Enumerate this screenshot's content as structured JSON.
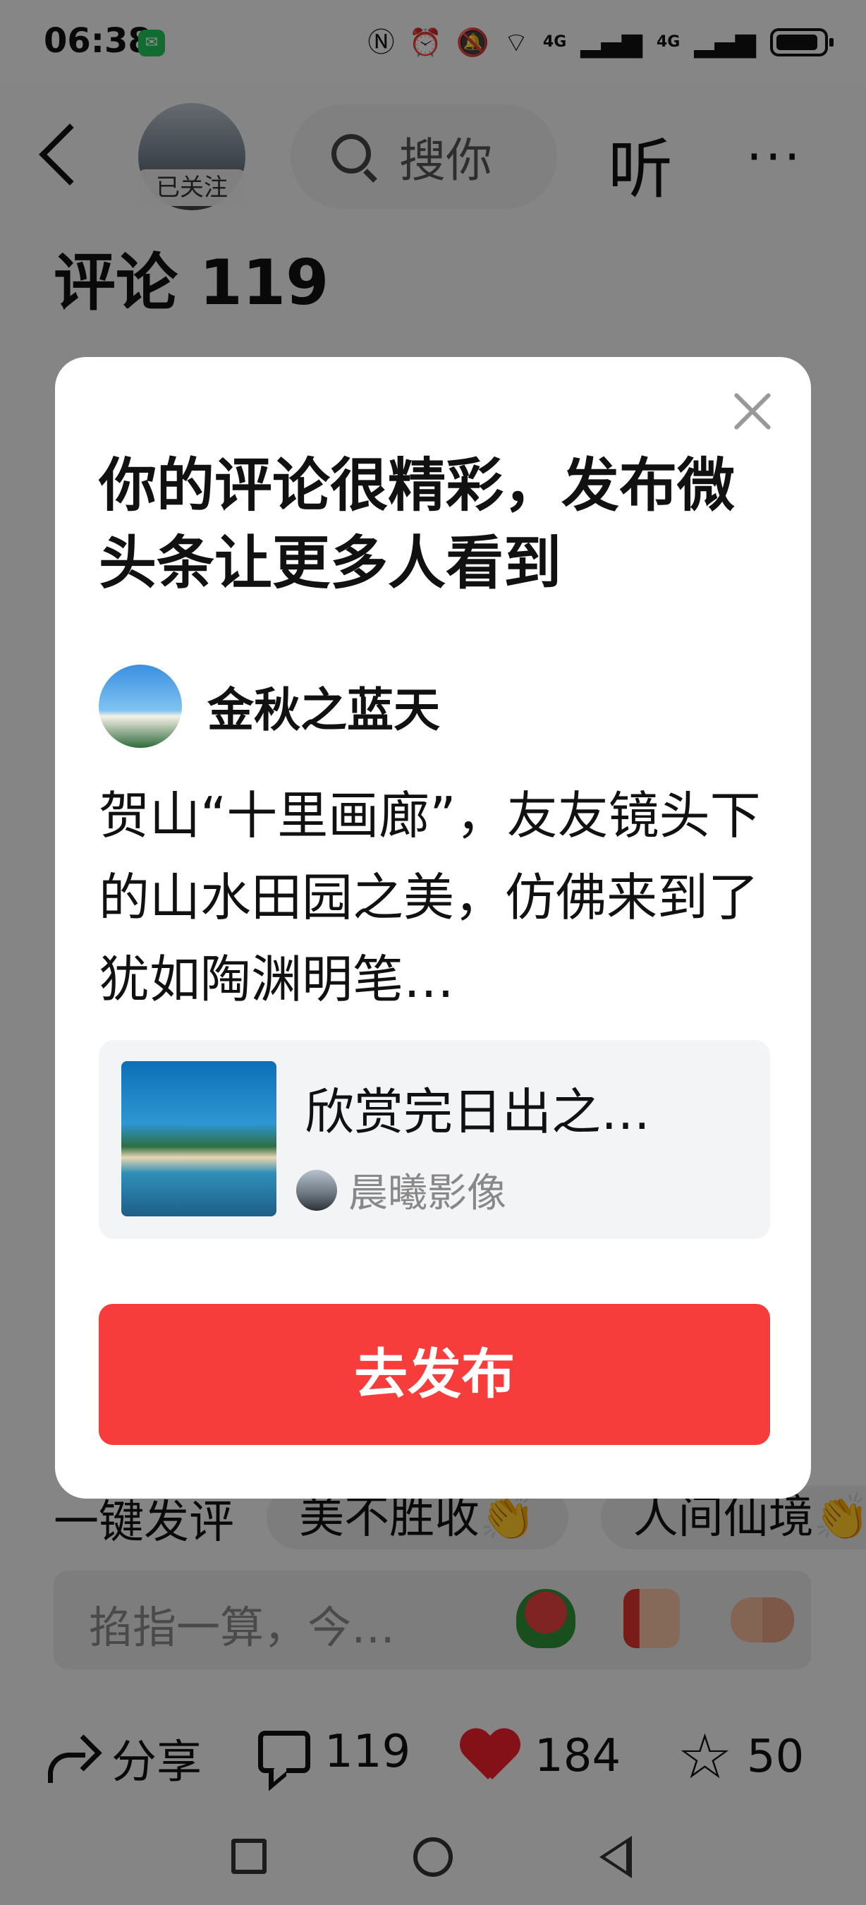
{
  "status_bar": {
    "time": "06:38",
    "network_1": "4G",
    "network_2": "4G"
  },
  "header": {
    "follow_badge": "已关注",
    "search_placeholder": "搜你",
    "listen_label": "听",
    "more_label": "···"
  },
  "comments_title": "评论 119",
  "dialog": {
    "title": "你的评论很精彩，发布微头条让更多人看到",
    "user_name": "金秋之蓝天",
    "comment_text": "贺山“十里画廊”，友友镜头下的山水田园之美，仿佛来到了犹如陶渊明笔…",
    "article": {
      "title": "欣赏完日出之…",
      "author": "晨曦影像"
    },
    "publish_button": "去发布"
  },
  "quick_replies": [
    "一键发评",
    "美不胜收👏",
    "人间仙境👏"
  ],
  "comment_bar": {
    "placeholder": "掐指一算，今…"
  },
  "actions": {
    "share_label": "分享",
    "comment_count": "119",
    "like_count": "184",
    "favorite_count": "50"
  },
  "colors": {
    "accent": "#f73c3c",
    "like_heart": "#f01f2a",
    "scrim": "rgba(0,0,0,0.45)"
  },
  "icons": {
    "back": "chevron-left-icon",
    "search": "search-icon",
    "close": "close-icon",
    "share": "share-icon",
    "comment": "comment-icon",
    "like": "heart-icon",
    "favorite": "star-icon"
  }
}
